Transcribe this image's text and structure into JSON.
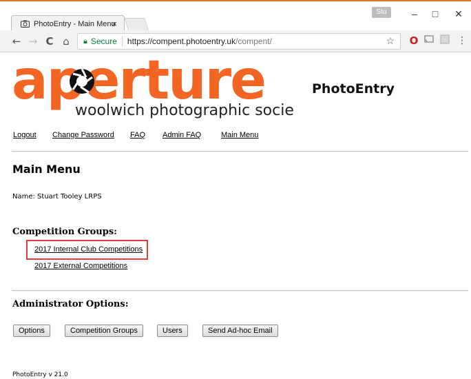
{
  "browser": {
    "tab_title": "PhotoEntry - Main Menu",
    "tab_close": "×",
    "profile": "Stu",
    "window_controls": {
      "minimize": "–",
      "maximize": "□",
      "close": "✕"
    },
    "nav": {
      "back": "←",
      "forward": "→",
      "reload": "C",
      "home": "⌂"
    },
    "address": {
      "security_label": "Secure",
      "host": "https://compent.photoentry.uk",
      "path": "/compent/"
    },
    "toolbar_icons": [
      "star-icon",
      "opera-icon",
      "cast-icon",
      "extension-icon",
      "menu-icon"
    ]
  },
  "header": {
    "logo_word": "aperture",
    "logo_tagline": "woolwich photographic society",
    "brand_title": "PhotoEntry"
  },
  "nav_links": [
    "Logout",
    "Change Password",
    "FAQ",
    "Admin FAQ",
    "Main Menu"
  ],
  "main": {
    "title": "Main Menu",
    "name_line": "Name: Stuart Tooley LRPS",
    "competition_groups_heading": "Competition Groups:",
    "competition_groups": [
      "2017 Internal Club Competitions",
      "2017 External Competitions"
    ],
    "admin_heading": "Administrator Options:",
    "admin_buttons": [
      "Options",
      "Competition Groups",
      "Users",
      "Send Ad-hoc Email"
    ]
  },
  "footer": {
    "version": "PhotoEntry v 21.0"
  },
  "colors": {
    "brand_orange": "#f26522",
    "highlight_red": "#d94040",
    "secure_green": "#0b8043"
  }
}
